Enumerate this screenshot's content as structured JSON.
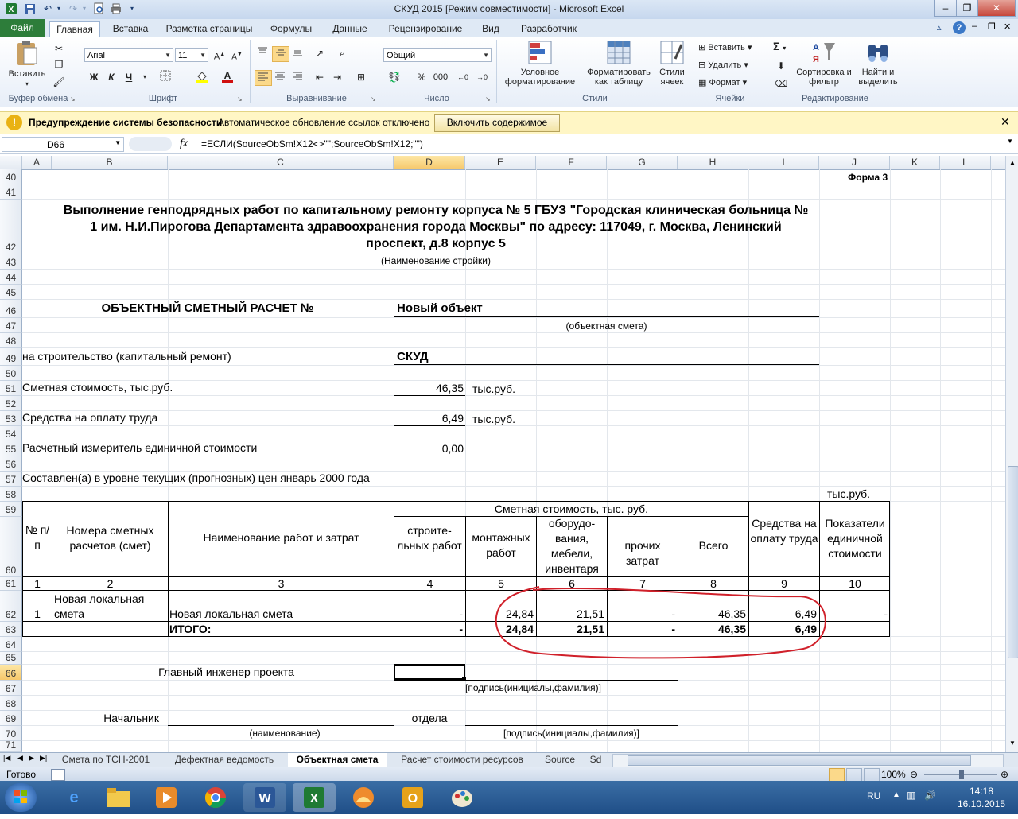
{
  "window": {
    "title": "СКУД 2015  [Режим совместимости] - Microsoft Excel"
  },
  "ribbon": {
    "tabs": [
      "Файл",
      "Главная",
      "Вставка",
      "Разметка страницы",
      "Формулы",
      "Данные",
      "Рецензирование",
      "Вид",
      "Разработчик"
    ],
    "active_tab": "Главная",
    "clipboard": {
      "paste": "Вставить",
      "label": "Буфер обмена"
    },
    "font": {
      "name": "Arial",
      "size": "11",
      "label": "Шрифт",
      "bold": "Ж",
      "italic": "К",
      "underline": "Ч"
    },
    "alignment": {
      "label": "Выравнивание"
    },
    "number": {
      "format": "Общий",
      "label": "Число",
      "percent": "%",
      "thousands": "000"
    },
    "styles": {
      "conditional": "Условное форматирование",
      "as_table": "Форматировать как таблицу",
      "cell_styles": "Стили ячеек",
      "label": "Стили"
    },
    "cells": {
      "insert": "Вставить",
      "delete": "Удалить",
      "format": "Формат",
      "label": "Ячейки"
    },
    "editing": {
      "sum": "Σ",
      "sort": "Сортировка и фильтр",
      "find": "Найти и выделить",
      "label": "Редактирование"
    }
  },
  "security_bar": {
    "title": "Предупреждение системы безопасности",
    "message": "Автоматическое обновление ссылок отключено",
    "button": "Включить содержимое"
  },
  "formula_bar": {
    "name_box": "D66",
    "fx": "fx",
    "formula": "=ЕСЛИ(SourceObSm!X12<>\"\";SourceObSm!X12;\"\")"
  },
  "columns": [
    "A",
    "B",
    "C",
    "D",
    "E",
    "F",
    "G",
    "H",
    "I",
    "J",
    "K",
    "L"
  ],
  "rows": [
    "40",
    "41",
    "42",
    "43",
    "44",
    "45",
    "46",
    "47",
    "48",
    "49",
    "50",
    "51",
    "52",
    "53",
    "54",
    "55",
    "56",
    "57",
    "58",
    "59",
    "60",
    "61",
    "62",
    "63",
    "64",
    "65",
    "66",
    "67",
    "68",
    "69",
    "70",
    "71"
  ],
  "sheet": {
    "form": "Форма 3",
    "title_line1": "Выполнение генподрядных работ по капитальному ремонту корпуса № 5 ГБУЗ \"Городская клиническая больница №",
    "title_line2": "1 им. Н.И.Пирогова Департамента здравоохранения города Москвы\" по адресу: 117049, г. Москва, Ленинский",
    "title_line3": "проспект, д.8 корпус 5",
    "site_caption": "(Наименование стройки)",
    "estimate_label": "ОБЪЕКТНЫЙ СМЕТНЫЙ РАСЧЕТ №",
    "object_name": "Новый объект",
    "object_caption": "(объектная смета)",
    "construction_label": "на строительство (капитальный ремонт)",
    "construction_value": "СКУД",
    "cost_label": "Сметная стоимость, тыс.руб.",
    "cost_value": "46,35",
    "cost_unit": "тыс.руб.",
    "wages_label": "Средства на оплату труда",
    "wages_value": "6,49",
    "wages_unit": "тыс.руб.",
    "meter_label": "Расчетный измеритель единичной стоимости",
    "meter_value": "0,00",
    "prices_label": "Составлен(а) в уровне текущих (прогнозных) цен январь 2000 года",
    "table_unit": "тыс.руб.",
    "headers": {
      "num": "№ п/п",
      "est_nums": "Номера сметных расчетов (смет)",
      "work_name": "Наименование работ и затрат",
      "cost_group": "Сметная стоимость, тыс. руб.",
      "construction": "строите-льных работ",
      "installation": "монтажных работ",
      "equipment": "оборудо-вания, мебели, инвентаря",
      "other": "прочих затрат",
      "total": "Всего",
      "wages": "Средства на оплату труда",
      "indicators": "Показатели единичной стоимости"
    },
    "col_numbers": [
      "1",
      "2",
      "3",
      "4",
      "5",
      "6",
      "7",
      "8",
      "9",
      "10"
    ],
    "row62": {
      "num": "1",
      "est": "Новая локальная смета",
      "name": "Новая локальная смета",
      "c4": "-",
      "c5": "24,84",
      "c6": "21,51",
      "c7": "-",
      "c8": "46,35",
      "c9": "6,49",
      "c10": "-"
    },
    "row63": {
      "name": "ИТОГО:",
      "c4": "-",
      "c5": "24,84",
      "c6": "21,51",
      "c7": "-",
      "c8": "46,35",
      "c9": "6,49"
    },
    "chief_engineer": "Главный инженер проекта",
    "signature_caption": "[подпись(инициалы,фамилия)]",
    "head_label": "Начальник",
    "dept_label": "отдела",
    "name_caption": "(наименование)",
    "signature_caption2": "[подпись(инициалы,фамилия)]"
  },
  "sheet_tabs": [
    "Смета по ТСН-2001",
    "Дефектная ведомость",
    "Объектная смета",
    "Расчет стоимости ресурсов",
    "Source",
    "Sd"
  ],
  "active_sheet": "Объектная смета",
  "status": {
    "ready": "Готово",
    "zoom": "100%"
  },
  "taskbar": {
    "lang": "RU",
    "time": "14:18",
    "date": "16.10.2015"
  },
  "colors": {
    "excel_green": "#2d7d3a",
    "annotation_red": "#d0202a",
    "security_yellow": "#fff6c5"
  }
}
